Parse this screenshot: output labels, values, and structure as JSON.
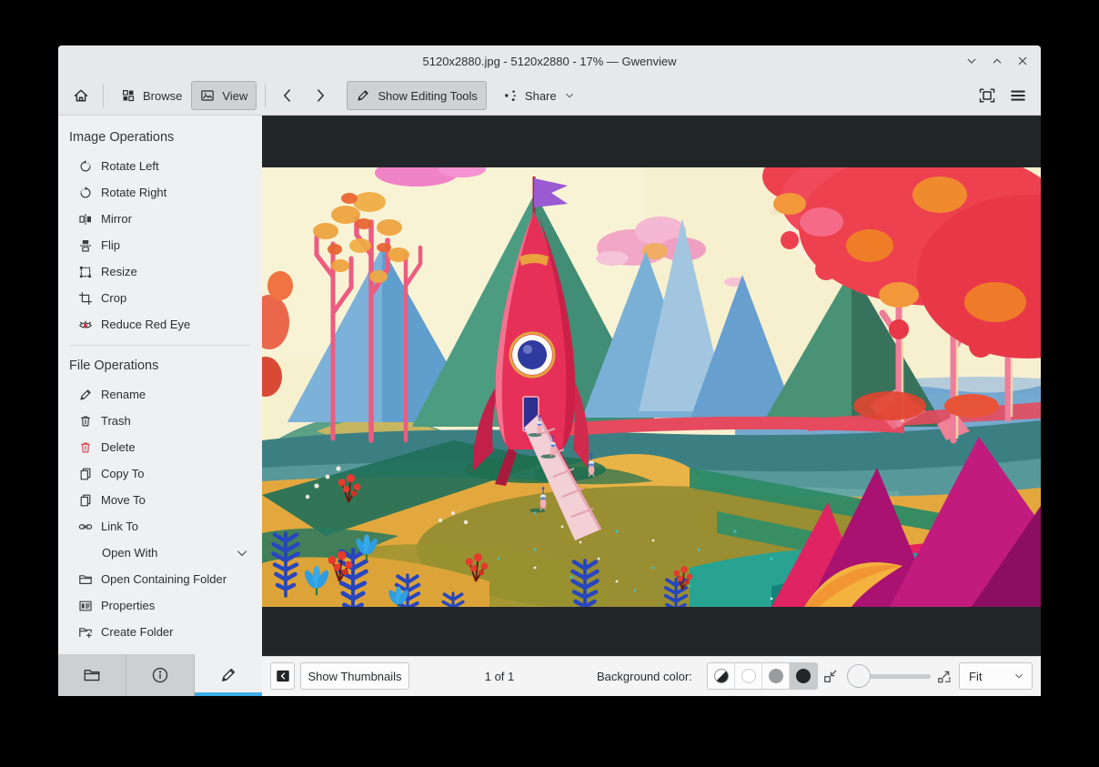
{
  "window": {
    "title": "5120x2880.jpg - 5120x2880 - 17% — Gwenview"
  },
  "toolbar": {
    "browse": "Browse",
    "view": "View",
    "show_editing_tools": "Show Editing Tools",
    "share": "Share"
  },
  "sidebar": {
    "image_operations": {
      "title": "Image Operations",
      "items": [
        {
          "label": "Rotate Left",
          "icon": "rotate-left-icon"
        },
        {
          "label": "Rotate Right",
          "icon": "rotate-right-icon"
        },
        {
          "label": "Mirror",
          "icon": "mirror-icon"
        },
        {
          "label": "Flip",
          "icon": "flip-icon"
        },
        {
          "label": "Resize",
          "icon": "resize-icon"
        },
        {
          "label": "Crop",
          "icon": "crop-icon"
        },
        {
          "label": "Reduce Red Eye",
          "icon": "red-eye-icon"
        }
      ]
    },
    "file_operations": {
      "title": "File Operations",
      "items": [
        {
          "label": "Rename",
          "icon": "rename-icon"
        },
        {
          "label": "Trash",
          "icon": "trash-icon"
        },
        {
          "label": "Delete",
          "icon": "delete-icon"
        },
        {
          "label": "Copy To",
          "icon": "copy-icon"
        },
        {
          "label": "Move To",
          "icon": "move-icon"
        },
        {
          "label": "Link To",
          "icon": "link-icon"
        },
        {
          "label": "Open With",
          "icon": "none",
          "has_submenu": true
        },
        {
          "label": "Open Containing Folder",
          "icon": "folder-open-icon"
        },
        {
          "label": "Properties",
          "icon": "properties-icon"
        },
        {
          "label": "Create Folder",
          "icon": "new-folder-icon"
        }
      ]
    }
  },
  "statusbar": {
    "show_thumbnails": "Show Thumbnails",
    "page_indicator": "1 of 1",
    "background_color_label": "Background color:",
    "zoom_mode": "Fit"
  },
  "colors": {
    "accent": "#3daee9",
    "delete_red": "#da4453",
    "canvas_bg": "#232629"
  }
}
